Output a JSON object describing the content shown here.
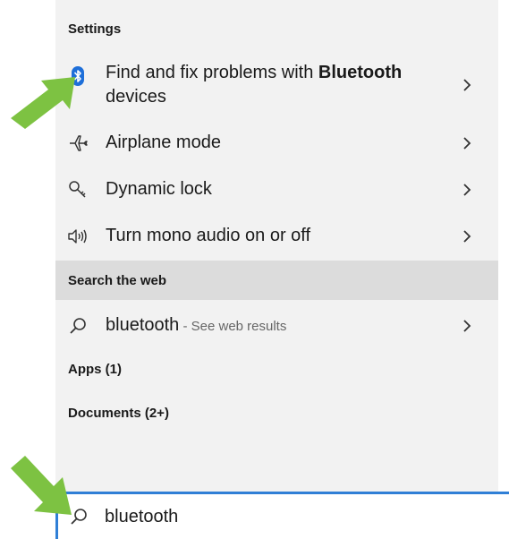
{
  "sections": {
    "settings": "Settings",
    "web": "Search the web",
    "apps": "Apps (1)",
    "documents": "Documents (2+)"
  },
  "settings_items": [
    {
      "label_prefix": "Find and fix problems with ",
      "label_bold": "Bluetooth",
      "label_suffix": "devices",
      "icon": "bluetooth-icon"
    },
    {
      "label": "Airplane mode",
      "icon": "airplane-icon"
    },
    {
      "label": "Dynamic lock",
      "icon": "key-icon"
    },
    {
      "label": "Turn mono audio on or off",
      "icon": "speaker-icon"
    }
  ],
  "web_result": {
    "query": "bluetooth",
    "hint": " - See web results",
    "icon": "search-icon"
  },
  "search": {
    "value": "bluetooth",
    "placeholder": ""
  },
  "colors": {
    "accent": "#2f7fd6",
    "bluetooth": "#1e6fd9",
    "annotation_arrow": "#7dc242",
    "panel": "#f2f2f2",
    "header_shade": "#dcdcdc"
  }
}
